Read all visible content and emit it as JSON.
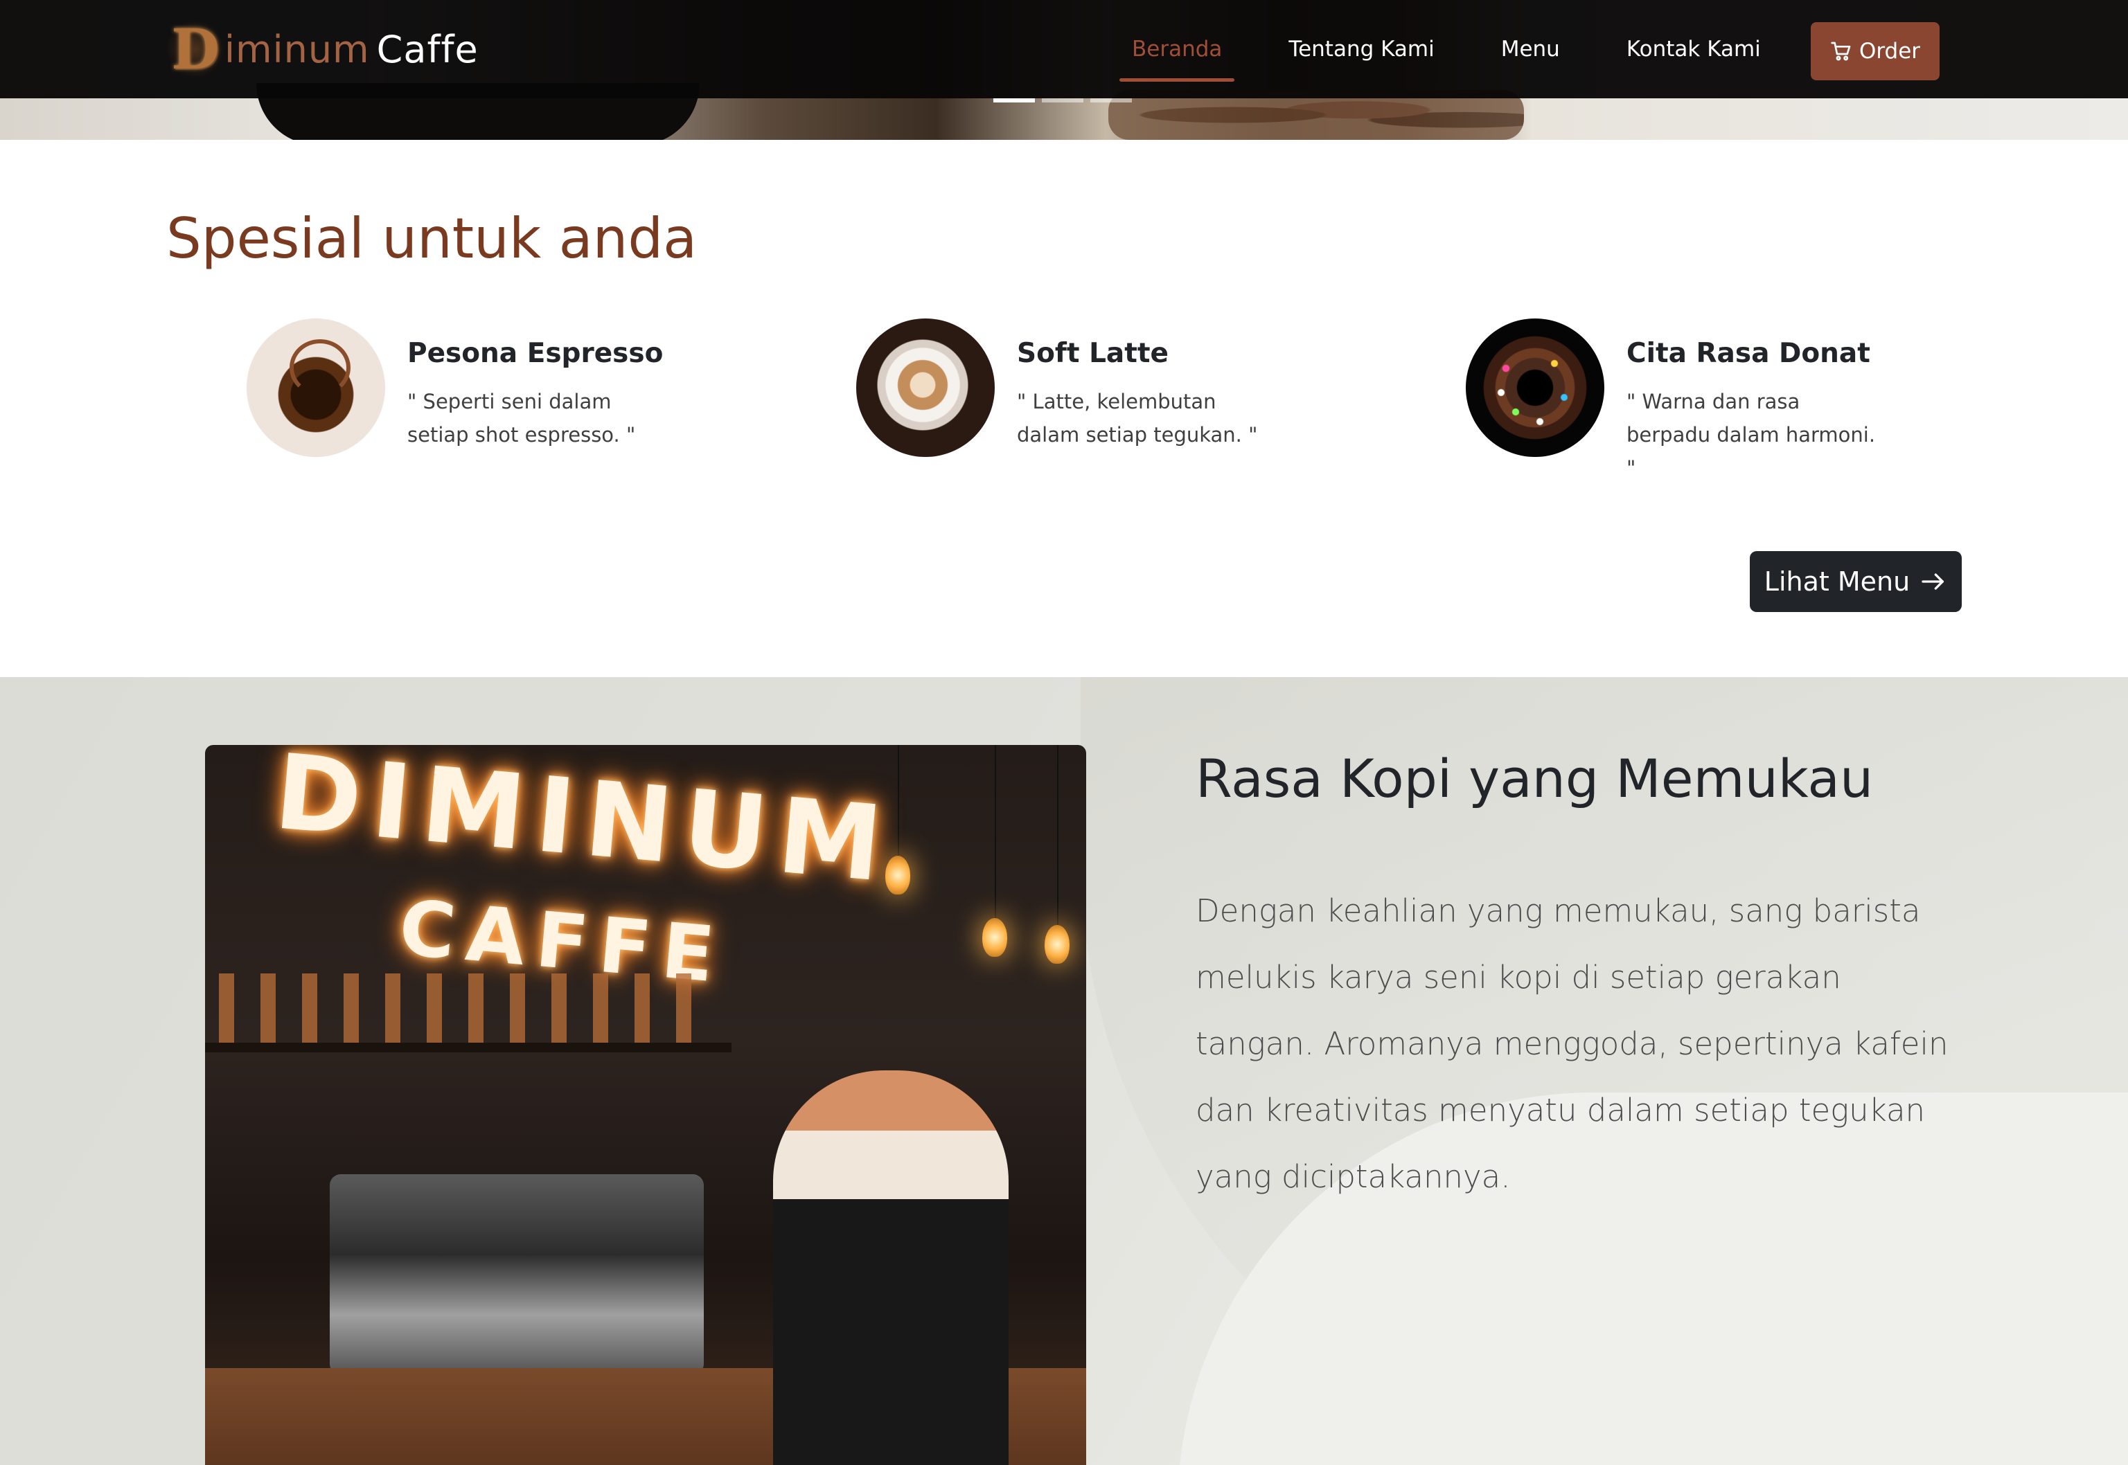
{
  "navbar": {
    "brand": {
      "logo_letter": "D",
      "text_1": "iminum",
      "text_2": "Caffe"
    },
    "links": [
      {
        "label": "Beranda",
        "active": true
      },
      {
        "label": "Tentang Kami",
        "active": false
      },
      {
        "label": "Menu",
        "active": false
      },
      {
        "label": "Kontak Kami",
        "active": false
      }
    ],
    "order_button": {
      "label": "Order",
      "icon": "cart-icon"
    }
  },
  "carousel": {
    "slides": 3,
    "active_index": 0
  },
  "specials": {
    "title": "Spesial untuk anda",
    "items": [
      {
        "name": "Pesona Espresso",
        "description": "\" Seperti seni dalam setiap shot espresso. \""
      },
      {
        "name": "Soft Latte",
        "description": "\" Latte, kelembutan dalam setiap tegukan. \""
      },
      {
        "name": "Cita Rasa Donat",
        "description": "\" Warna dan rasa berpadu dalam harmoni. \""
      }
    ],
    "menu_button": {
      "label": "Lihat Menu",
      "icon": "arrow-right-icon"
    }
  },
  "about": {
    "image_sign": {
      "line_1": "DIMINUM",
      "line_2": "CAFFE"
    },
    "title": "Rasa Kopi yang Memukau",
    "text": "Dengan keahlian yang memukau, sang barista melukis karya seni kopi di setiap gerakan tangan. Aromanya menggoda, sepertinya kafein dan kreativitas menyatu dalam setiap tegukan yang diciptakannya."
  },
  "colors": {
    "accent": "#a04f36",
    "order_button": "#8a4631",
    "title_brown": "#7a3a20",
    "dark_button": "#212529"
  }
}
